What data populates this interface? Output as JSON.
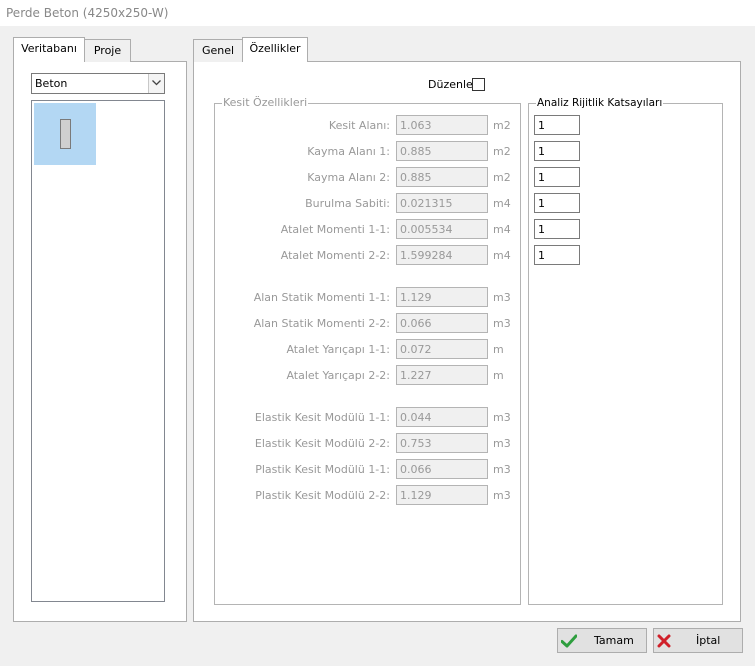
{
  "window": {
    "title": "Perde Beton (4250x250-W)"
  },
  "left_tabs": [
    {
      "label": "Veritabanı"
    },
    {
      "label": "Proje"
    }
  ],
  "material_select": {
    "value": "Beton"
  },
  "right_tabs": [
    {
      "label": "Genel"
    },
    {
      "label": "Özellikler"
    }
  ],
  "edit_checkbox": {
    "label": "Düzenle",
    "checked": false
  },
  "section_props": {
    "legend": "Kesit Özellikleri",
    "rows": [
      {
        "label": "Kesit Alanı:",
        "value": "1.063",
        "unit": "m2"
      },
      {
        "label": "Kayma Alanı 1:",
        "value": "0.885",
        "unit": "m2"
      },
      {
        "label": "Kayma Alanı 2:",
        "value": "0.885",
        "unit": "m2"
      },
      {
        "label": "Burulma Sabiti:",
        "value": "0.021315",
        "unit": "m4"
      },
      {
        "label": "Atalet Momenti 1-1:",
        "value": "0.005534",
        "unit": "m4"
      },
      {
        "label": "Atalet Momenti 2-2:",
        "value": "1.599284",
        "unit": "m4"
      },
      {
        "label": "Alan Statik Momenti 1-1:",
        "value": "1.129",
        "unit": "m3"
      },
      {
        "label": "Alan Statik Momenti 2-2:",
        "value": "0.066",
        "unit": "m3"
      },
      {
        "label": "Atalet Yarıçapı 1-1:",
        "value": "0.072",
        "unit": "m"
      },
      {
        "label": "Atalet Yarıçapı 2-2:",
        "value": "1.227",
        "unit": "m"
      },
      {
        "label": "Elastik Kesit Modülü 1-1:",
        "value": "0.044",
        "unit": "m3"
      },
      {
        "label": "Elastik Kesit Modülü 2-2:",
        "value": "0.753",
        "unit": "m3"
      },
      {
        "label": "Plastik Kesit Modülü 1-1:",
        "value": "0.066",
        "unit": "m3"
      },
      {
        "label": "Plastik Kesit Modülü 2-2:",
        "value": "1.129",
        "unit": "m3"
      }
    ]
  },
  "stiffness": {
    "legend": "Analiz Rijitlik Katsayıları",
    "values": [
      "1",
      "1",
      "1",
      "1",
      "1",
      "1"
    ]
  },
  "buttons": {
    "ok": {
      "label": "Tamam",
      "icon": "checkmark-icon",
      "color": "#2e9e3e"
    },
    "cancel": {
      "label": "İptal",
      "icon": "x-icon",
      "color": "#d0202a"
    }
  }
}
